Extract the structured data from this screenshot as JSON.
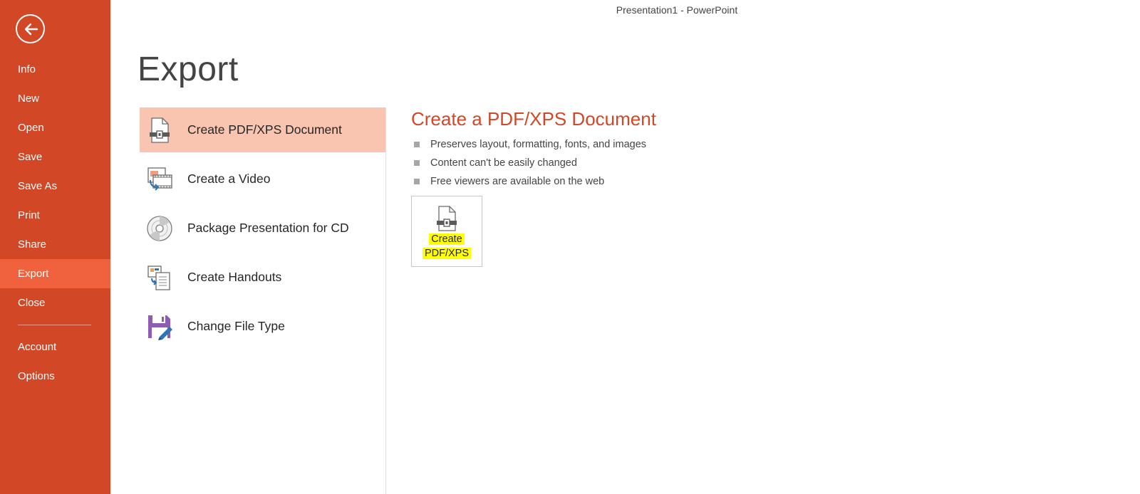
{
  "window": {
    "title": "Presentation1 - PowerPoint"
  },
  "sidebar": {
    "back_icon": "back-arrow-icon",
    "items": [
      {
        "label": "Info"
      },
      {
        "label": "New"
      },
      {
        "label": "Open"
      },
      {
        "label": "Save"
      },
      {
        "label": "Save As"
      },
      {
        "label": "Print"
      },
      {
        "label": "Share"
      },
      {
        "label": "Export",
        "active": true
      },
      {
        "label": "Close"
      }
    ],
    "footer_items": [
      {
        "label": "Account"
      },
      {
        "label": "Options"
      }
    ]
  },
  "page": {
    "title": "Export"
  },
  "options": [
    {
      "label": "Create PDF/XPS Document",
      "icon": "pdf-document-icon",
      "selected": true
    },
    {
      "label": "Create a Video",
      "icon": "video-icon"
    },
    {
      "label": "Package Presentation for CD",
      "icon": "cd-icon"
    },
    {
      "label": "Create Handouts",
      "icon": "handouts-icon"
    },
    {
      "label": "Change File Type",
      "icon": "save-file-type-icon"
    }
  ],
  "detail": {
    "title": "Create a PDF/XPS Document",
    "bullets": [
      "Preserves layout, formatting, fonts, and images",
      "Content can't be easily changed",
      "Free viewers are available on the web"
    ],
    "button": {
      "line1": "Create",
      "line2": "PDF/XPS",
      "icon": "pdf-document-icon"
    }
  },
  "colors": {
    "accent": "#d24726",
    "sidebar_active": "#f0623e",
    "selected_option": "#f9c5b1",
    "highlight": "#ffff00"
  }
}
